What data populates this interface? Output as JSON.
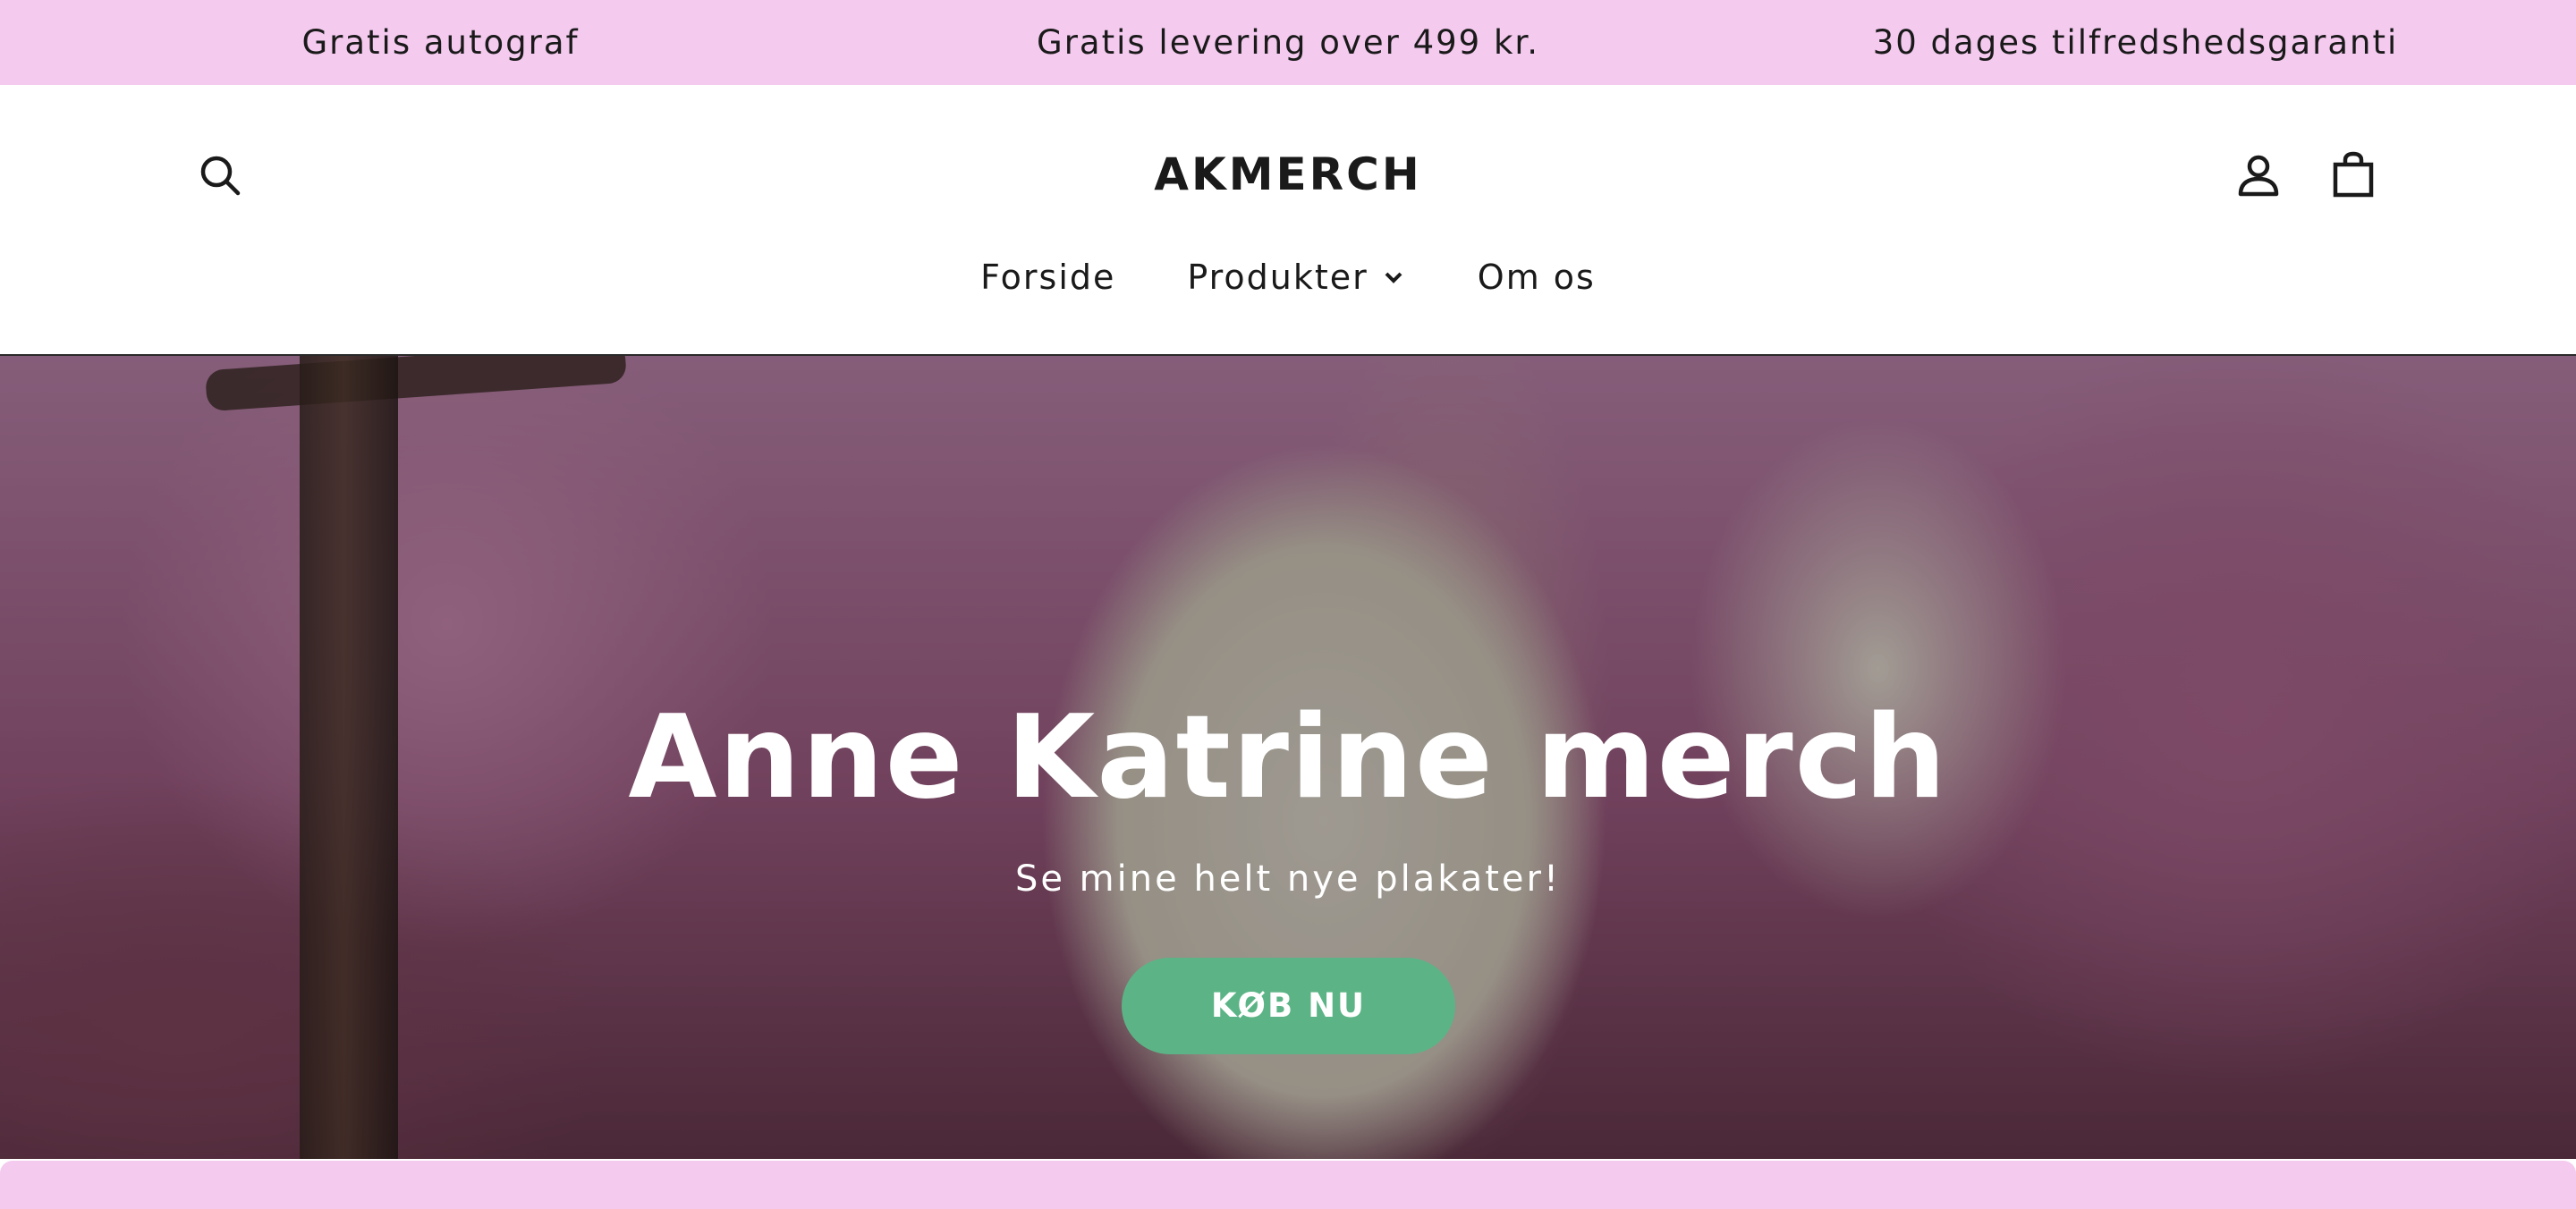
{
  "announcement": {
    "items": [
      "Gratis autograf",
      "Gratis levering over 499 kr.",
      "30 dages tilfredshedsgaranti"
    ]
  },
  "header": {
    "logo": "AKMERCH",
    "icons": {
      "search": "search-icon",
      "account": "user-icon",
      "cart": "shopping-bag-icon"
    }
  },
  "nav": {
    "items": [
      {
        "label": "Forside"
      },
      {
        "label": "Produkter",
        "has_dropdown": true
      },
      {
        "label": "Om os"
      }
    ]
  },
  "hero": {
    "title": "Anne Katrine merch",
    "subtitle": "Se mine helt nye plakater!",
    "cta_label": "KØB NU"
  },
  "colors": {
    "announcement_bg": "#f4caef",
    "cta_bg": "#5cb486",
    "text": "#1a1a1a"
  }
}
